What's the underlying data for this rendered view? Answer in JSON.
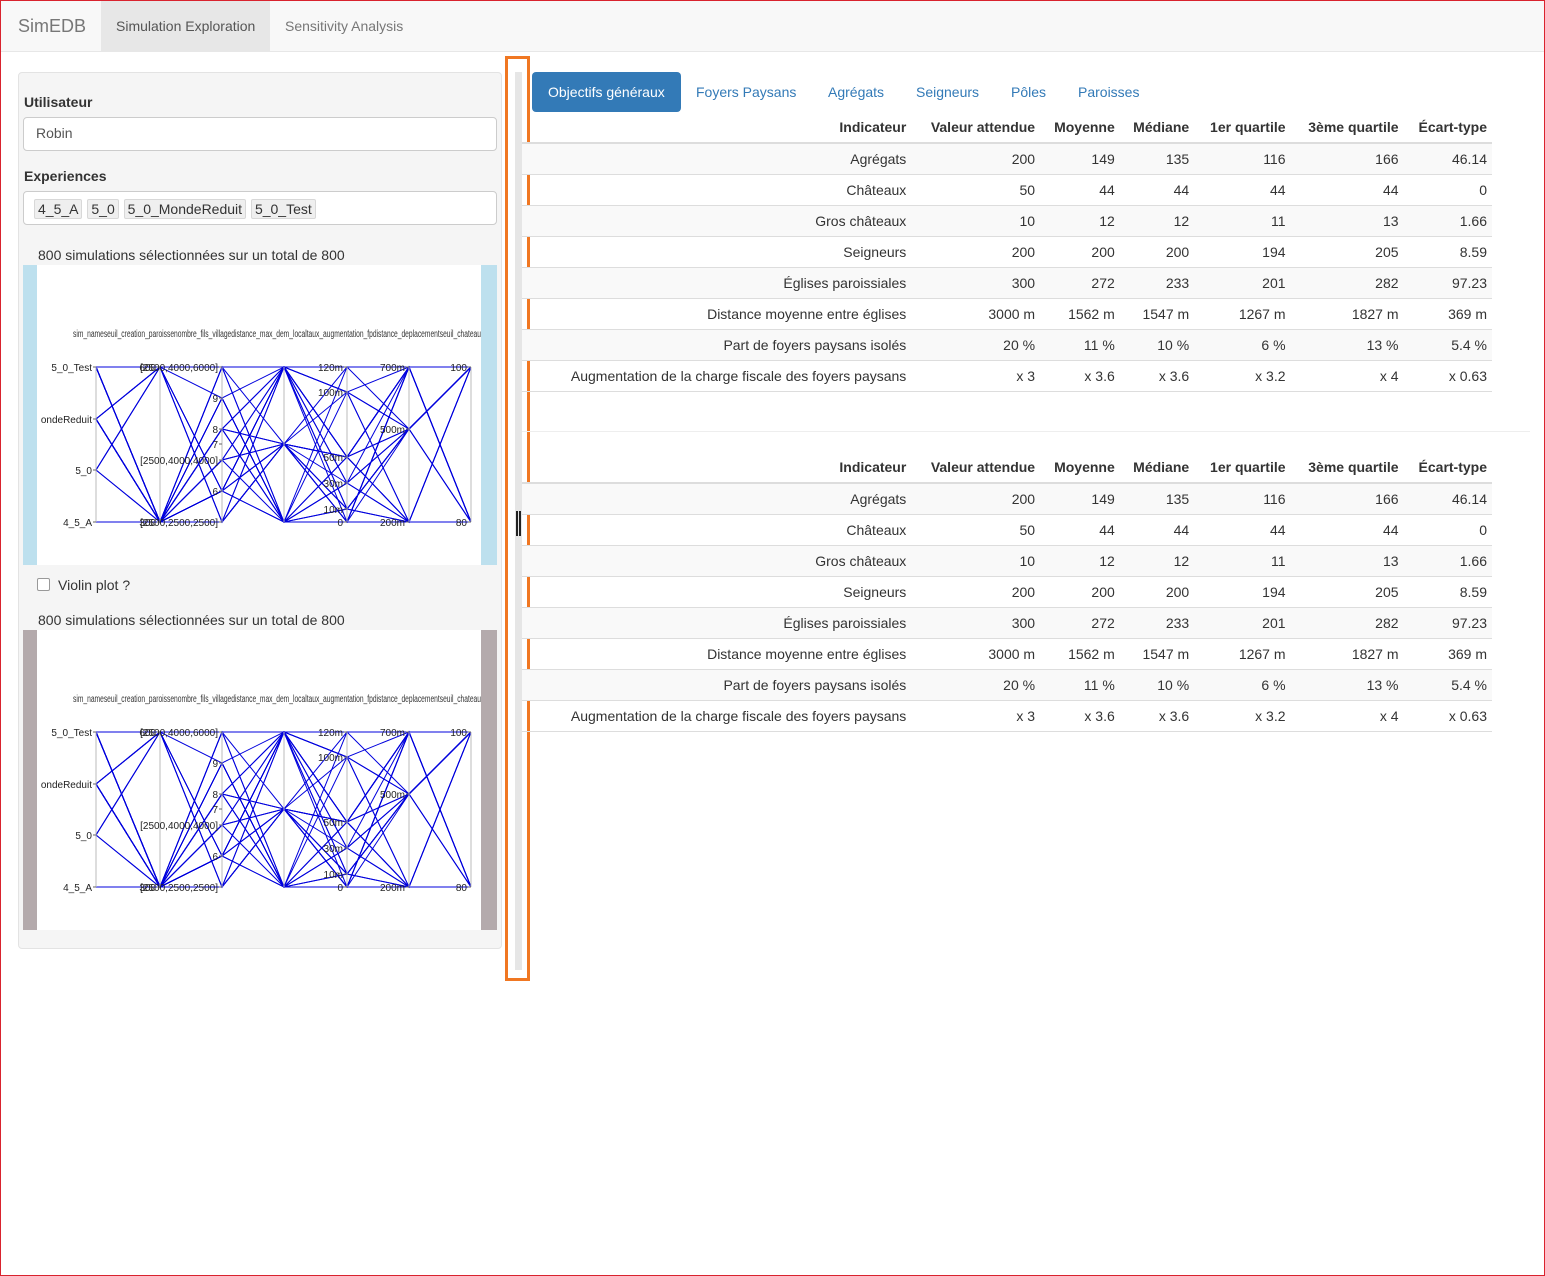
{
  "navbar": {
    "brand": "SimEDB",
    "tabs": [
      {
        "label": "Simulation Exploration",
        "active": true
      },
      {
        "label": "Sensitivity Analysis",
        "active": false
      }
    ]
  },
  "sidebar": {
    "user_label": "Utilisateur",
    "user_value": "Robin",
    "experiences_label": "Experiences",
    "experiences": [
      "4_5_A",
      "5_0",
      "5_0_MondeReduit",
      "5_0_Test"
    ],
    "selection_text_1": "800 simulations sélectionnées sur un total de 800",
    "selection_text_2": "800 simulations sélectionnées sur un total de 800",
    "violin_label": "Violin plot ?",
    "violin_checked": false
  },
  "chart_data": [
    {
      "type": "parallel-coordinates",
      "frame_color": "#bde0ee",
      "line_color": "#0000dd",
      "axes": [
        {
          "name": "sim_name",
          "ticks": [
            "5_0_Test",
            "ondeReduit",
            "5_0",
            "4_5_A"
          ]
        },
        {
          "name": "seuil_creation_paroisse",
          "ticks": [
            "600",
            "300"
          ]
        },
        {
          "name": "nombre_fils_village",
          "ticks": [
            "[2500,4000,6000]",
            "9",
            "8",
            "7",
            "[2500,4000,4000]",
            "6",
            "[2500,2500,2500]"
          ]
        },
        {
          "name": "distance_max_dem_local",
          "ticks": []
        },
        {
          "name": "taux_augmentation_fp",
          "ticks": [
            "120m",
            "100m",
            "50m",
            "30m",
            "10m",
            "0"
          ]
        },
        {
          "name": "distance_deplacement",
          "ticks": [
            "700m",
            "500m",
            "200m"
          ]
        },
        {
          "name": "seuil_chateau",
          "ticks": [
            "100",
            "80"
          ]
        }
      ],
      "axis_title_strip": "sim_nameseuil_creation_paroissenombre_fils_villagedistance_max_dem_localtaux_augmentation_fpdistance_deplacementseuil_chateau"
    },
    {
      "type": "parallel-coordinates",
      "frame_color": "#b4aaac",
      "line_color": "#0000dd",
      "axes": [
        {
          "name": "sim_name",
          "ticks": [
            "5_0_Test",
            "ondeReduit",
            "5_0",
            "4_5_A"
          ]
        },
        {
          "name": "seuil_creation_paroisse",
          "ticks": [
            "600",
            "300"
          ]
        },
        {
          "name": "nombre_fils_village",
          "ticks": [
            "[2500,4000,6000]",
            "9",
            "8",
            "7",
            "[2500,4000,4000]",
            "6",
            "[2500,2500,2500]"
          ]
        },
        {
          "name": "distance_max_dem_local",
          "ticks": []
        },
        {
          "name": "taux_augmentation_fp",
          "ticks": [
            "120m",
            "100m",
            "50m",
            "30m",
            "10m",
            "0"
          ]
        },
        {
          "name": "distance_deplacement",
          "ticks": [
            "700m",
            "500m",
            "200m"
          ]
        },
        {
          "name": "seuil_chateau",
          "ticks": [
            "100",
            "80"
          ]
        }
      ],
      "axis_title_strip": "sim_nameseuil_creation_paroissenombre_fils_villagedistance_max_dem_localtaux_augmentation_fpdistance_deplacementseuil_chateau"
    }
  ],
  "main": {
    "tabs": [
      {
        "label": "Objectifs généraux",
        "active": true
      },
      {
        "label": "Foyers Paysans",
        "active": false
      },
      {
        "label": "Agrégats",
        "active": false
      },
      {
        "label": "Seigneurs",
        "active": false
      },
      {
        "label": "Pôles",
        "active": false
      },
      {
        "label": "Paroisses",
        "active": false
      }
    ],
    "table_headers": [
      "Indicateur",
      "Valeur attendue",
      "Moyenne",
      "Médiane",
      "1er quartile",
      "3ème quartile",
      "Écart-type"
    ],
    "tables": [
      {
        "rows": [
          [
            "Agrégats",
            "200",
            "149",
            "135",
            "116",
            "166",
            "46.14"
          ],
          [
            "Châteaux",
            "50",
            "44",
            "44",
            "44",
            "44",
            "0"
          ],
          [
            "Gros châteaux",
            "10",
            "12",
            "12",
            "11",
            "13",
            "1.66"
          ],
          [
            "Seigneurs",
            "200",
            "200",
            "200",
            "194",
            "205",
            "8.59"
          ],
          [
            "Églises paroissiales",
            "300",
            "272",
            "233",
            "201",
            "282",
            "97.23"
          ],
          [
            "Distance moyenne entre églises",
            "3000 m",
            "1562 m",
            "1547 m",
            "1267 m",
            "1827 m",
            "369 m"
          ],
          [
            "Part de foyers paysans isolés",
            "20 %",
            "11 %",
            "10 %",
            "6 %",
            "13 %",
            "5.4 %"
          ],
          [
            "Augmentation de la charge fiscale des foyers paysans",
            "x 3",
            "x 3.6",
            "x 3.6",
            "x 3.2",
            "x 4",
            "x 0.63"
          ]
        ]
      },
      {
        "rows": [
          [
            "Agrégats",
            "200",
            "149",
            "135",
            "116",
            "166",
            "46.14"
          ],
          [
            "Châteaux",
            "50",
            "44",
            "44",
            "44",
            "44",
            "0"
          ],
          [
            "Gros châteaux",
            "10",
            "12",
            "12",
            "11",
            "13",
            "1.66"
          ],
          [
            "Seigneurs",
            "200",
            "200",
            "200",
            "194",
            "205",
            "8.59"
          ],
          [
            "Églises paroissiales",
            "300",
            "272",
            "233",
            "201",
            "282",
            "97.23"
          ],
          [
            "Distance moyenne entre églises",
            "3000 m",
            "1562 m",
            "1547 m",
            "1267 m",
            "1827 m",
            "369 m"
          ],
          [
            "Part de foyers paysans isolés",
            "20 %",
            "11 %",
            "10 %",
            "6 %",
            "13 %",
            "5.4 %"
          ],
          [
            "Augmentation de la charge fiscale des foyers paysans",
            "x 3",
            "x 3.6",
            "x 3.6",
            "x 3.2",
            "x 4",
            "x 0.63"
          ]
        ]
      }
    ]
  }
}
